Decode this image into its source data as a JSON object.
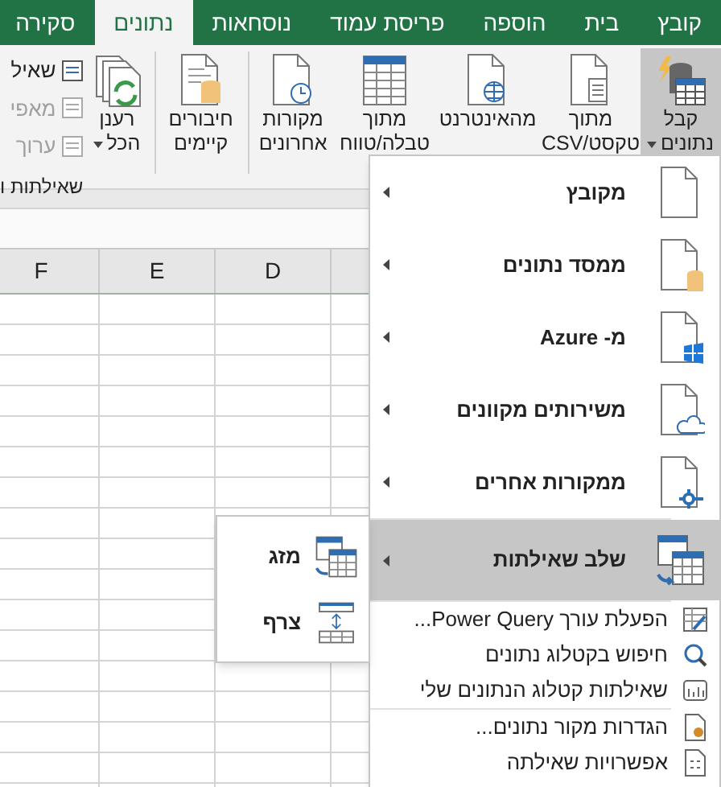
{
  "tabs": [
    {
      "label": "קובץ",
      "selected": false
    },
    {
      "label": "בית",
      "selected": false
    },
    {
      "label": "הוספה",
      "selected": false
    },
    {
      "label": "פריסת עמוד",
      "selected": false
    },
    {
      "label": "נוסחאות",
      "selected": false
    },
    {
      "label": "נתונים",
      "selected": true
    },
    {
      "label": "סקירה",
      "selected": false
    }
  ],
  "ribbon": {
    "buttons": [
      {
        "label": "קבל\nנתונים",
        "kind": "get",
        "selected": true,
        "dropdown": true
      },
      {
        "label": "מתוך\nטקסט/CSV",
        "kind": "text",
        "selected": false,
        "dropdown": false
      },
      {
        "label": "מהאינטרנט",
        "kind": "web",
        "selected": false,
        "dropdown": false
      },
      {
        "label": "מתוך\nטבלה/טווח",
        "kind": "table",
        "selected": false,
        "dropdown": false
      },
      {
        "label": "מקורות\nאחרונים",
        "kind": "recent",
        "selected": false,
        "dropdown": false
      },
      {
        "label": "חיבורים\nקיימים",
        "kind": "existing",
        "selected": false,
        "dropdown": false
      },
      {
        "label": "רענן\nהכל",
        "kind": "refresh",
        "selected": false,
        "dropdown": true
      }
    ],
    "small_buttons": [
      {
        "label": "שאיל",
        "disabled": false
      },
      {
        "label": "מאפי",
        "disabled": true
      },
      {
        "label": "ערוך",
        "disabled": true
      }
    ],
    "group_label": "שאילתות ו"
  },
  "columns": [
    "D",
    "E",
    "F"
  ],
  "menu": {
    "items": [
      {
        "label": "מקובץ",
        "kind": "big",
        "selected": false
      },
      {
        "label": "ממסד נתונים",
        "kind": "big",
        "selected": false
      },
      {
        "label": "מ- Azure",
        "kind": "big",
        "selected": false
      },
      {
        "label": "משירותים מקוונים",
        "kind": "big",
        "selected": false
      },
      {
        "label": "ממקורות אחרים",
        "kind": "big",
        "selected": false
      },
      {
        "label": "שלב שאילתות",
        "kind": "big",
        "selected": true
      },
      {
        "label": "הפעלת עורך Power Query...",
        "kind": "small",
        "selected": false
      },
      {
        "label": "חיפוש בקטלוג נתונים",
        "kind": "small",
        "selected": false
      },
      {
        "label": "שאילתות קטלוג הנתונים שלי",
        "kind": "small",
        "selected": false
      },
      {
        "label": "הגדרות מקור נתונים...",
        "kind": "small",
        "selected": false
      },
      {
        "label": "אפשרויות שאילתה",
        "kind": "small",
        "selected": false
      }
    ]
  },
  "submenu": {
    "items": [
      "מזג",
      "צרף"
    ]
  }
}
